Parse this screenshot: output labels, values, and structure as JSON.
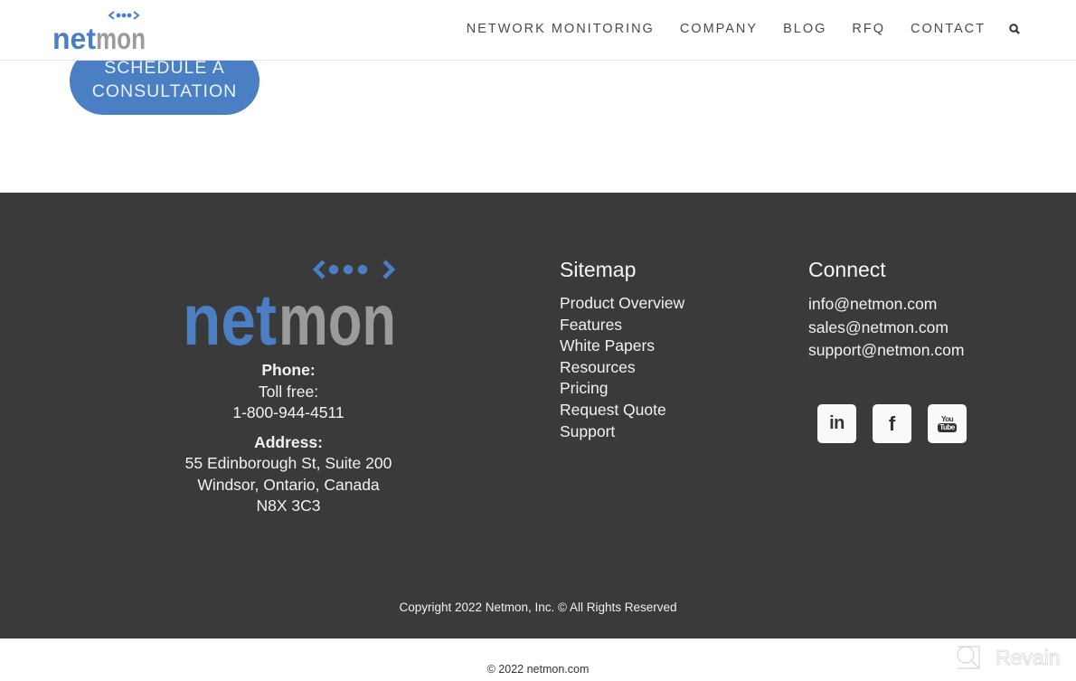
{
  "header": {
    "logo": {
      "left": "net",
      "right": "mon",
      "alt": "netmon"
    },
    "nav": [
      {
        "label": "NETWORK MONITORING"
      },
      {
        "label": "COMPANY"
      },
      {
        "label": "BLOG"
      },
      {
        "label": "RFQ"
      },
      {
        "label": "CONTACT"
      }
    ],
    "search_icon": "search-icon"
  },
  "cta": {
    "line1": "SCHEDULE A",
    "line2": "CONSULTATION"
  },
  "footer": {
    "logo": {
      "left": "net",
      "right": "mon"
    },
    "contact": {
      "phone_label": "Phone:",
      "toll_free": "Toll free:",
      "phone": "1-800-944-4511",
      "address_label": "Address:",
      "address_line1": "55 Edinborough St, Suite 200",
      "address_line2": "Windsor, Ontario, Canada",
      "postal": "N8X 3C3"
    },
    "sitemap": {
      "title": "Sitemap",
      "links": [
        {
          "label": "Product Overview"
        },
        {
          "label": "Features"
        },
        {
          "label": "White Papers"
        },
        {
          "label": "Resources"
        },
        {
          "label": "Pricing"
        },
        {
          "label": "Request Quote"
        },
        {
          "label": "Support"
        }
      ]
    },
    "connect": {
      "title": "Connect",
      "emails": [
        {
          "label": "info@netmon.com"
        },
        {
          "label": "sales@netmon.com"
        },
        {
          "label": "support@netmon.com"
        }
      ],
      "socials": [
        {
          "name": "linkedin",
          "glyph": "in"
        },
        {
          "name": "facebook",
          "glyph": "f"
        },
        {
          "name": "youtube",
          "top": "You",
          "bottom": "Tube"
        }
      ]
    },
    "copyright": "Copyright 2022 Netmon, Inc. © All Rights Reserved"
  },
  "bottom": {
    "copyright": "© 2022 netmon.com",
    "watermark": "Revain"
  },
  "colors": {
    "brand_blue": "#4a7fc4",
    "brand_gray": "#9b9b9b",
    "footer_bg": "#3a3a3a"
  }
}
